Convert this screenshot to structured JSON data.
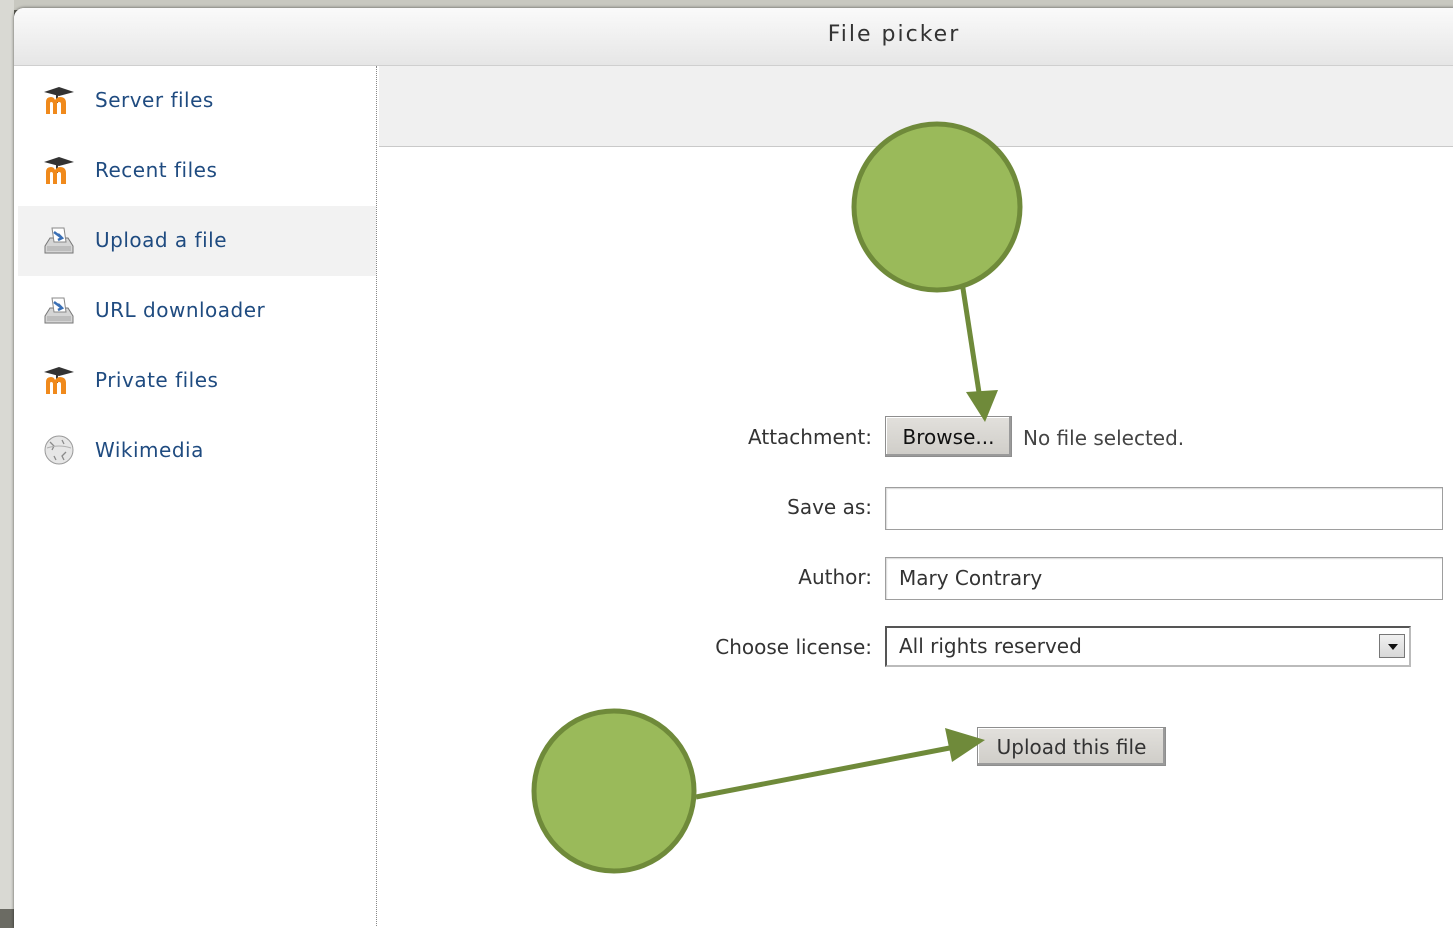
{
  "dialog": {
    "title": "File picker"
  },
  "sidebar": {
    "items": [
      {
        "label": "Server files",
        "icon": "moodle-icon"
      },
      {
        "label": "Recent files",
        "icon": "moodle-icon"
      },
      {
        "label": "Upload a file",
        "icon": "upload-icon",
        "active": true
      },
      {
        "label": "URL downloader",
        "icon": "download-icon"
      },
      {
        "label": "Private files",
        "icon": "moodle-icon"
      },
      {
        "label": "Wikimedia",
        "icon": "wikimedia-globe-icon"
      }
    ]
  },
  "form": {
    "attachment_label": "Attachment:",
    "browse_label": "Browse...",
    "no_file_text": "No file selected.",
    "save_as_label": "Save as:",
    "save_as_value": "",
    "author_label": "Author:",
    "author_value": "Mary Contrary",
    "license_label": "Choose license:",
    "license_value": "All rights reserved",
    "upload_label": "Upload this file"
  },
  "annotations": {
    "marker_color": "#9aba5a",
    "marker_stroke": "#6f8a3a"
  },
  "colors": {
    "link": "#1f4b80",
    "moodle_orange": "#f08a1c"
  }
}
